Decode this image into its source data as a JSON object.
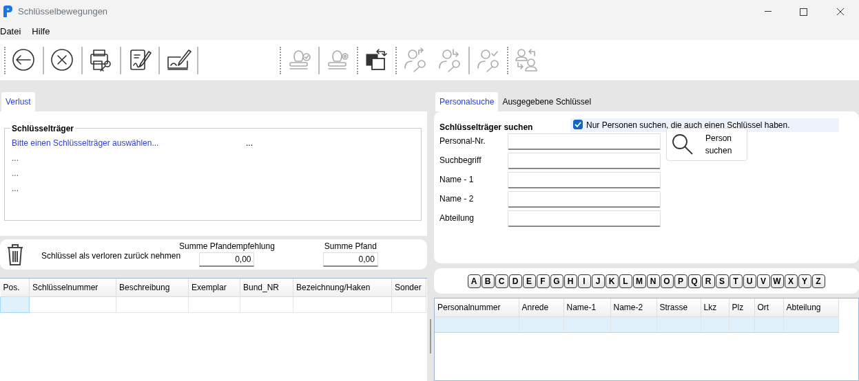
{
  "window": {
    "title": "Schlüsselbewegungen"
  },
  "menu": [
    "Datei",
    "Hilfe"
  ],
  "toolbar": [
    {
      "kind": "separator",
      "dotted": true
    },
    {
      "kind": "button",
      "disabled": false
    },
    {
      "kind": "separator",
      "dotted": false
    },
    {
      "kind": "button",
      "disabled": false
    },
    {
      "kind": "separator",
      "dotted": false
    },
    {
      "kind": "button",
      "disabled": false
    },
    {
      "kind": "separator",
      "dotted": false
    },
    {
      "kind": "button",
      "disabled": false
    },
    {
      "kind": "separator",
      "dotted": false
    },
    {
      "kind": "button",
      "disabled": false
    },
    {
      "kind": "separator",
      "dotted": false
    },
    {
      "kind": "spacer"
    },
    {
      "kind": "separator",
      "dotted": true
    },
    {
      "kind": "button",
      "disabled": true
    },
    {
      "kind": "separator",
      "dotted": false
    },
    {
      "kind": "button",
      "disabled": true
    },
    {
      "kind": "separator",
      "dotted": true
    },
    {
      "kind": "button",
      "disabled": false
    },
    {
      "kind": "separator",
      "dotted": true
    },
    {
      "kind": "button",
      "disabled": true
    },
    {
      "kind": "button",
      "disabled": true
    },
    {
      "kind": "separator",
      "dotted": false
    },
    {
      "kind": "button",
      "disabled": true
    },
    {
      "kind": "separator",
      "dotted": true
    },
    {
      "kind": "button",
      "disabled": true
    }
  ],
  "left_tabs": [
    {
      "label": "Verlust",
      "selected": true
    }
  ],
  "key_holder": {
    "title": "Schlüsselträger",
    "prompt": "Bitte einen Schlüsselträger auswählen...",
    "side": "...",
    "lines": [
      "...",
      "...",
      "..."
    ]
  },
  "loss": {
    "label": "Schlüssel als verloren zurück nehmen",
    "sums": [
      {
        "label": "Summe Pfandempfehlung",
        "value": "0,00"
      },
      {
        "label": "Summe Pfand",
        "value": "0,00"
      }
    ]
  },
  "keys_table": {
    "columns": [
      "Pos.",
      "Schlüsselnummer",
      "Beschreibung",
      "Exemplar",
      "Bund_NR",
      "Bezeichnung/Haken",
      "Sonder"
    ],
    "rows": [
      {
        "selected": true
      }
    ]
  },
  "right_tabs": [
    {
      "label": "Personalsuche",
      "selected": true
    },
    {
      "label": "Ausgegebene Schlüssel",
      "selected": false
    }
  ],
  "search": {
    "title": "Schlüsselträger suchen",
    "only_with_key": {
      "label": "Nur Personen suchen, die auch einen Schlüssel haben.",
      "checked": true
    },
    "fields": [
      {
        "label": "Personal-Nr."
      },
      {
        "label": "Suchbegriff"
      },
      {
        "label": "Name - 1"
      },
      {
        "label": "Name - 2"
      },
      {
        "label": "Abteilung"
      }
    ],
    "button": "Person suchen"
  },
  "letters": [
    "A",
    "B",
    "C",
    "D",
    "E",
    "F",
    "G",
    "H",
    "I",
    "J",
    "K",
    "L",
    "M",
    "N",
    "O",
    "P",
    "Q",
    "R",
    "S",
    "T",
    "U",
    "V",
    "W",
    "X",
    "Y",
    "Z"
  ],
  "persons_table": {
    "columns": [
      "Personalnummer",
      "Anrede",
      "Name-1",
      "Name-2",
      "Strasse",
      "Lkz",
      "Plz",
      "Ort",
      "Abteilung"
    ],
    "rows": [
      {
        "selected": true
      }
    ]
  }
}
